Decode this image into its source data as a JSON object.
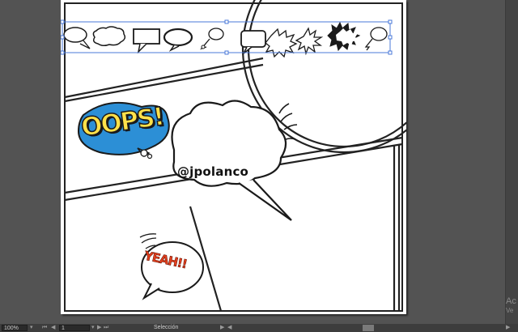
{
  "canvas": {
    "handle_text": "@jpolanco",
    "oops_text": "OOPS!",
    "yeah_text": "YEAH!!",
    "bubble_count_in_selection": 10
  },
  "status_bar": {
    "zoom": "100%",
    "artboard_number": "1",
    "tool": "Selección",
    "nav_first": "⏮",
    "nav_prev": "◀",
    "nav_next": "▶",
    "nav_last": "⏭",
    "play": "▶",
    "dropdown": "▾"
  },
  "watermark": {
    "line1": "Ac",
    "line2": "Ve"
  },
  "colors": {
    "workspace": "#535353",
    "selection": "#4a78d8",
    "oops_yellow": "#ffe14a",
    "oops_blue": "#2c8fd6",
    "yeah_red": "#e4401e"
  }
}
